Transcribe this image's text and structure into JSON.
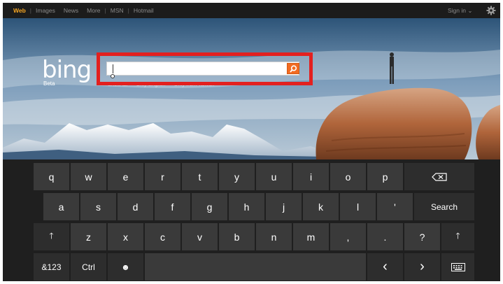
{
  "topbar": {
    "nav": [
      "Web",
      "Images",
      "News",
      "More",
      "MSN",
      "Hotmail"
    ],
    "sign_in": "Sign in",
    "sign_in_chevron": "⌄",
    "settings_icon": "gear-icon"
  },
  "hero": {
    "logo": "bing",
    "beta": "Beta",
    "search": {
      "value": "",
      "placeholder": ""
    },
    "scope_options": [
      "Show all",
      "Only English",
      "Only from Taiwan"
    ]
  },
  "keyboard": {
    "row1": [
      "q",
      "w",
      "e",
      "r",
      "t",
      "y",
      "u",
      "i",
      "o",
      "p"
    ],
    "row2": [
      "a",
      "s",
      "d",
      "f",
      "g",
      "h",
      "j",
      "k",
      "l",
      "'"
    ],
    "row3": [
      "z",
      "x",
      "c",
      "v",
      "b",
      "n",
      "m",
      ",",
      ".",
      "?"
    ],
    "search_label": "Search",
    "symbols_label": "&123",
    "ctrl_label": "Ctrl",
    "emoji_glyph": "☻",
    "shift_glyph": "🡑",
    "left_glyph": "‹",
    "right_glyph": "›",
    "icons": [
      "backspace-icon",
      "shift-icon",
      "emoji-icon",
      "keyboard-icon"
    ]
  },
  "colors": {
    "active_tab": "#f6a623",
    "highlight_box": "#e3201f",
    "search_button": "#f26b21",
    "key": "#3a3a3a",
    "keyboard_bg": "#1f1f1f"
  }
}
